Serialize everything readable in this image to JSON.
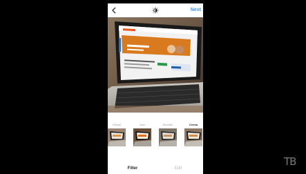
{
  "header": {
    "back_icon": "chevron-left-icon",
    "lux_icon": "lux-sun-icon",
    "next_label": "Next"
  },
  "filters": [
    {
      "label": "Reyes",
      "selected": false
    },
    {
      "label": "Juno",
      "selected": false
    },
    {
      "label": "Slumber",
      "selected": false
    },
    {
      "label": "Crema",
      "selected": true
    }
  ],
  "tabs": {
    "filter_label": "Filter",
    "edit_label": "Edit"
  },
  "watermark": "TB",
  "colors": {
    "accent": "#3897f0",
    "background": "#000000",
    "panel": "#ffffff"
  }
}
